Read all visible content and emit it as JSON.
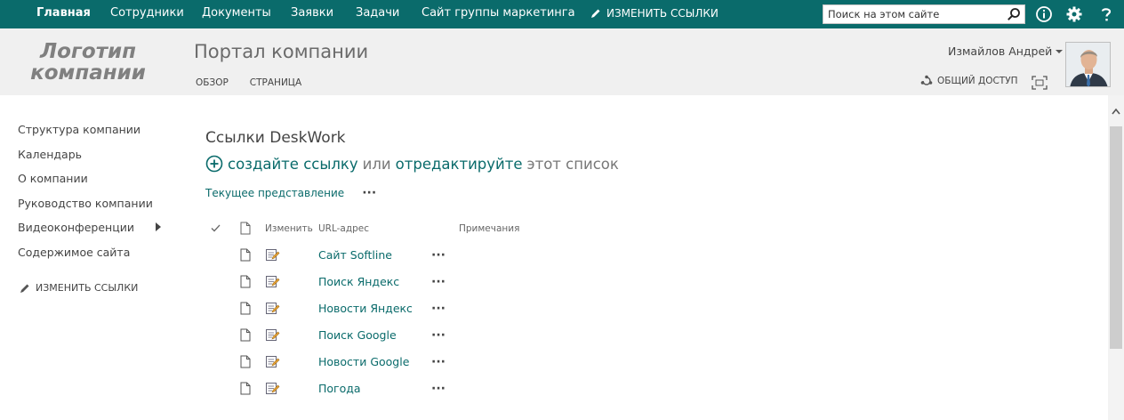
{
  "topnav": {
    "items": [
      {
        "label": "Главная",
        "active": true
      },
      {
        "label": "Сотрудники"
      },
      {
        "label": "Документы"
      },
      {
        "label": "Заявки"
      },
      {
        "label": "Задачи"
      },
      {
        "label": "Сайт группы маркетинга"
      }
    ],
    "edit_links": "ИЗМЕНИТЬ ССЫЛКИ",
    "search_placeholder": "Поиск на этом сайте",
    "icons": [
      "info-icon",
      "gear-icon",
      "help-icon"
    ]
  },
  "header": {
    "logo_line1": "Логотип",
    "logo_line2": "компании",
    "site_title": "Портал компании",
    "tabs": [
      "ОБЗОР",
      "СТРАНИЦА"
    ],
    "user_name": "Измайлов Андрей",
    "share_label": "ОБЩИЙ ДОСТУП"
  },
  "leftnav": {
    "items": [
      {
        "label": "Структура компании"
      },
      {
        "label": "Календарь"
      },
      {
        "label": "О компании"
      },
      {
        "label": "Руководство компании"
      },
      {
        "label": "Видеоконференции",
        "has_submenu": true
      },
      {
        "label": "Содержимое сайта"
      }
    ],
    "edit_links": "ИЗМЕНИТЬ ССЫЛКИ"
  },
  "main": {
    "list_title": "Ссылки DeskWork",
    "new_link": "создайте ссылку",
    "or_text": "или",
    "edit_link": "отредактируйте",
    "list_text": "этот список",
    "current_view": "Текущее представление",
    "columns": {
      "edit": "Изменить",
      "url": "URL-адрес",
      "notes": "Примечания"
    },
    "rows": [
      {
        "url": "Сайт Softline"
      },
      {
        "url": "Поиск Яндекс"
      },
      {
        "url": "Новости Яндекс"
      },
      {
        "url": "Поиск Google"
      },
      {
        "url": "Новости Google"
      },
      {
        "url": "Погода"
      }
    ]
  },
  "colors": {
    "accent": "#0a6b6b",
    "header_bg": "#f0f0f0",
    "text": "#444444"
  }
}
